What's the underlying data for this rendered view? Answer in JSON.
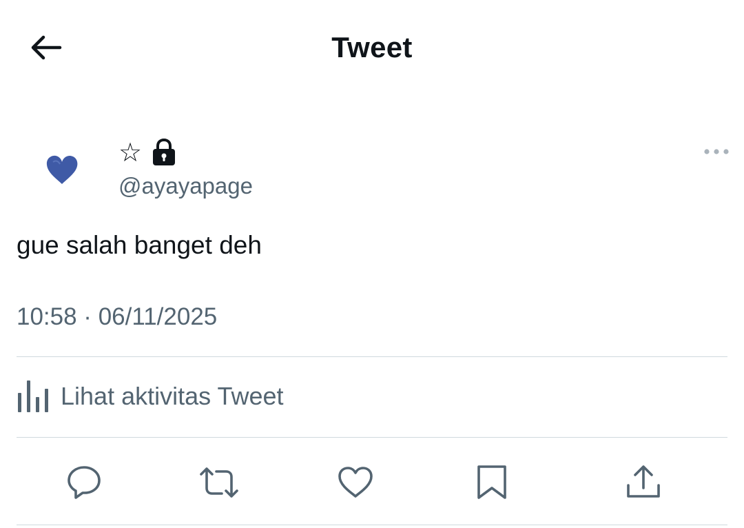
{
  "header": {
    "title": "Tweet",
    "back_icon": "arrow-left-icon"
  },
  "author": {
    "avatar_icon": "blue-heart",
    "display_name": "☆",
    "protected_icon": "lock-icon",
    "handle": "@ayayapage"
  },
  "tweet": {
    "text": "gue salah banget deh",
    "timestamp": "10:58 · 06/11/2025"
  },
  "activity": {
    "icon": "bar-chart-icon",
    "label": "Lihat aktivitas Tweet"
  },
  "actions": [
    {
      "name": "reply",
      "icon": "speech-bubble-icon"
    },
    {
      "name": "retweet",
      "icon": "retweet-icon"
    },
    {
      "name": "like",
      "icon": "heart-icon"
    },
    {
      "name": "bookmark",
      "icon": "bookmark-icon"
    },
    {
      "name": "share",
      "icon": "share-icon"
    }
  ],
  "colors": {
    "text_primary": "#0f1419",
    "text_secondary": "#536471",
    "divider": "#cfd9de",
    "avatar_heart": "#3f5aa6"
  }
}
